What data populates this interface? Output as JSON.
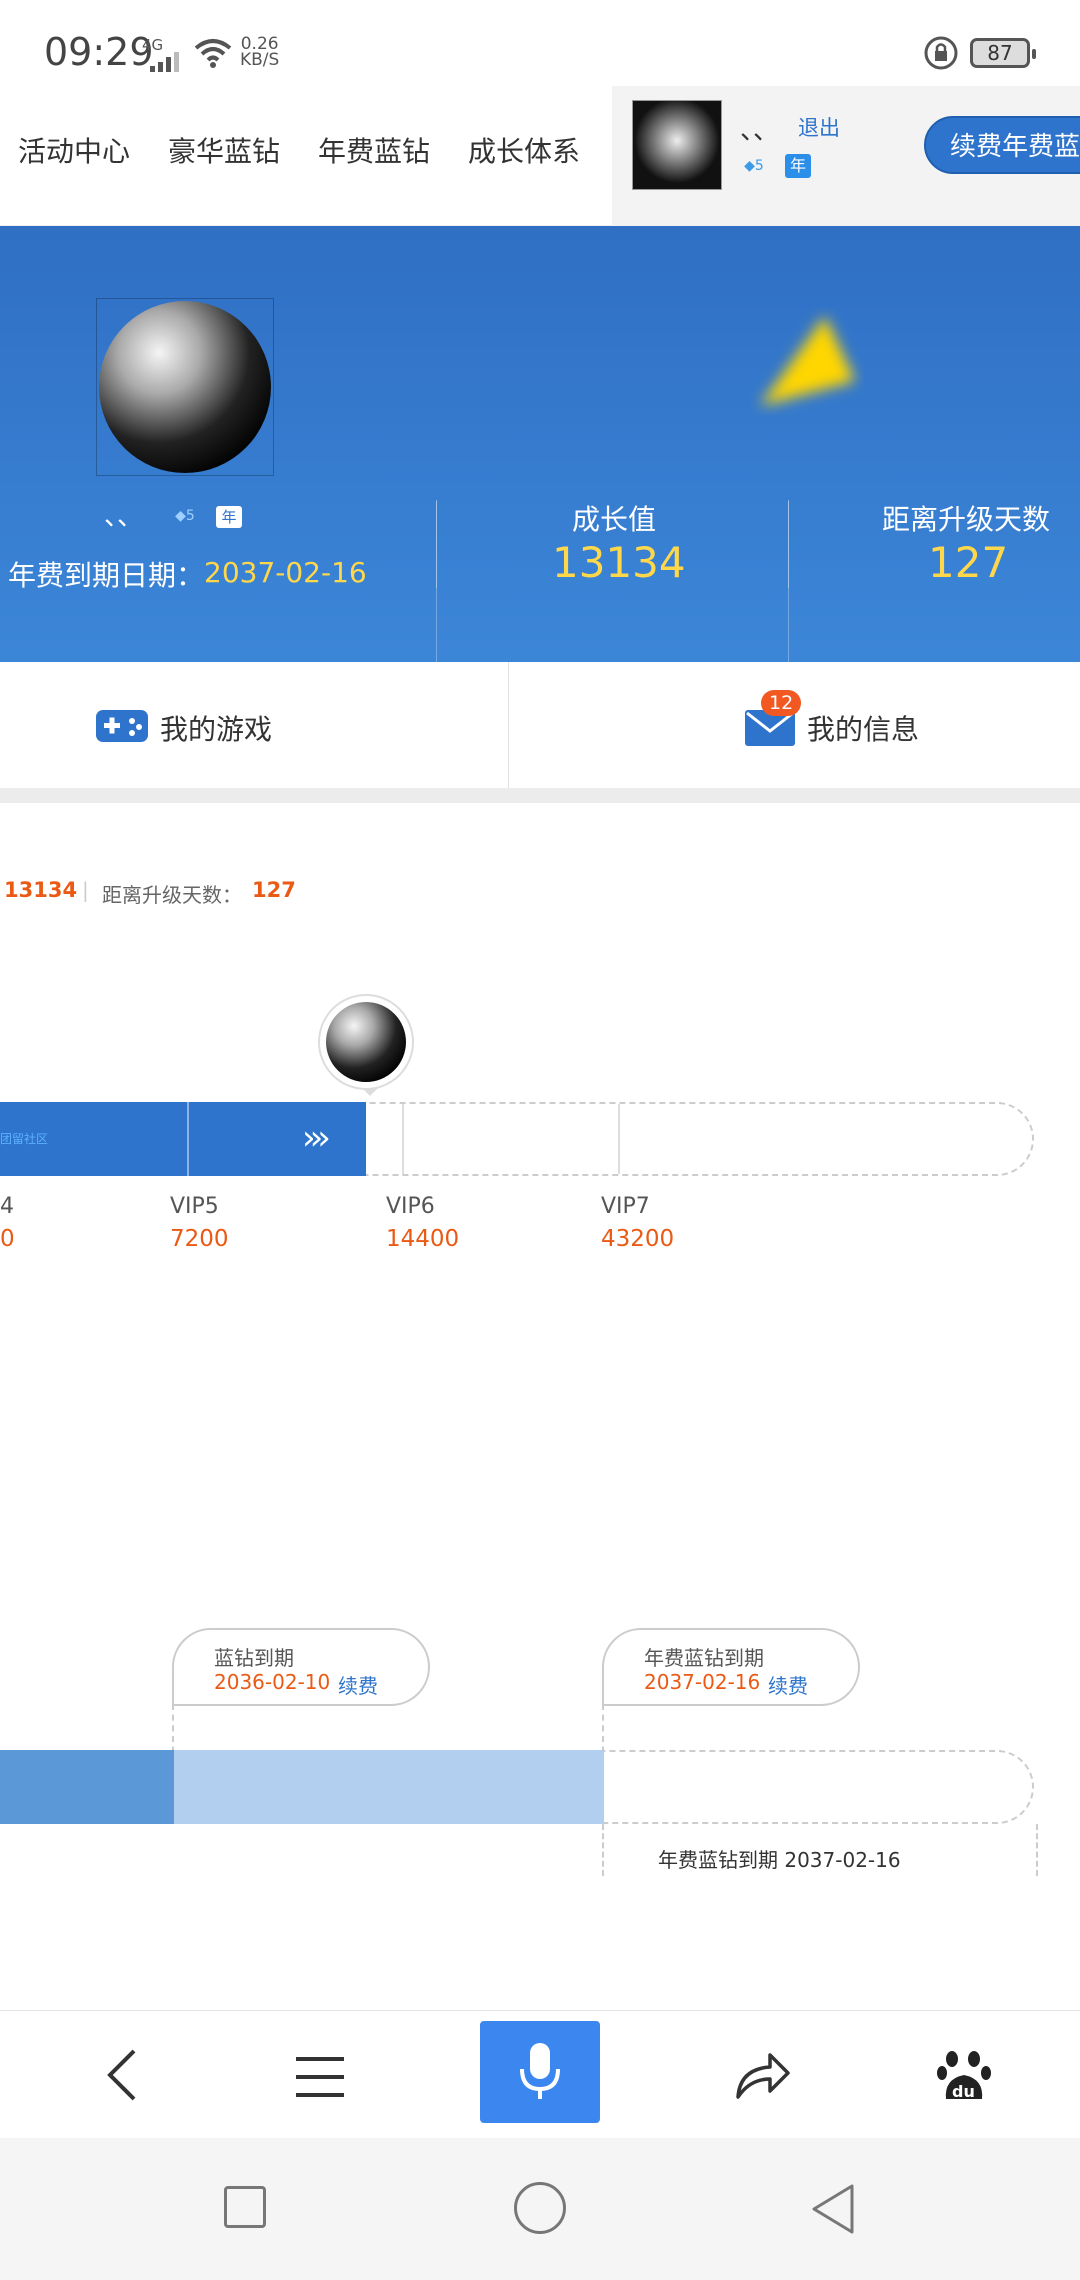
{
  "status_bar": {
    "time": "09:29",
    "network": "4G",
    "speed_value": "0.26",
    "speed_unit": "KB/S",
    "battery": "87"
  },
  "nav": {
    "items": [
      "活动中心",
      "豪华蓝钻",
      "年费蓝钻",
      "成长体系"
    ],
    "user_name": "、、",
    "logout": "退出",
    "badge_level": "5",
    "badge_year": "年",
    "renew_button": "续费年费蓝钻"
  },
  "hero": {
    "user_name": "、、",
    "badge_level": "5",
    "badge_year": "年",
    "expiry_label": "年费到期日期：",
    "expiry_date": "2037-02-16",
    "growth_label": "成长值",
    "growth_value": "13134",
    "days_label": "距离升级天数",
    "days_value": "127"
  },
  "tabs": {
    "games": "我的游戏",
    "messages": "我的信息",
    "message_count": "12"
  },
  "growth": {
    "value": "13134",
    "days_label": "距离升级天数：",
    "days_value": "127",
    "bar_text": "团留社区",
    "levels": [
      {
        "name": "4",
        "value": "0"
      },
      {
        "name": "VIP5",
        "value": "7200"
      },
      {
        "name": "VIP6",
        "value": "14400"
      },
      {
        "name": "VIP7",
        "value": "43200"
      }
    ]
  },
  "expiry": {
    "blue_title": "蓝钻到期",
    "blue_date": "2036-02-10",
    "blue_renew": "续费",
    "annual_title": "年费蓝钻到期",
    "annual_date": "2037-02-16",
    "annual_renew": "续费",
    "annual_caption": "年费蓝钻到期 2037-02-16"
  },
  "colors": {
    "accent_blue": "#2f74cc",
    "highlight_yellow": "#ffd74a",
    "value_orange": "#ea5a14"
  }
}
